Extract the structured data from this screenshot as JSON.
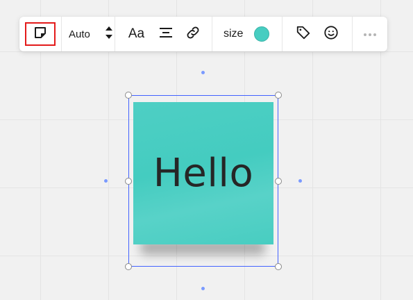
{
  "toolbar": {
    "sticky_note_icon": "sticky-note-icon",
    "sticky_note_selected": true,
    "auto_label": "Auto",
    "font_icon_label": "Aa",
    "size_label": "size",
    "note_color": "#47cdc1",
    "selected_outline_color": "#e31a1a",
    "icons": [
      "sticky-note-icon",
      "stepper-icon",
      "font-icon",
      "align-center-icon",
      "link-icon",
      "color-swatch",
      "tag-icon",
      "emoji-icon",
      "more-icon"
    ]
  },
  "canvas": {
    "sticky_note": {
      "text": "Hello",
      "color": "#47cdc1"
    },
    "selection_color": "#4262ff"
  }
}
